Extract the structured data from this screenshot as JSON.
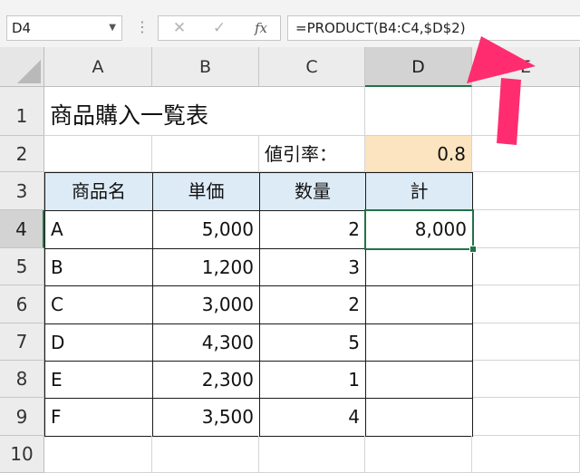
{
  "name_box": {
    "value": "D4"
  },
  "formula_bar": {
    "cancel": "✕",
    "enter": "✓",
    "fx": "fx",
    "formula": "=PRODUCT(B4:C4,$D$2)"
  },
  "columns": [
    "A",
    "B",
    "C",
    "D",
    "E"
  ],
  "rows": [
    "1",
    "2",
    "3",
    "4",
    "5",
    "6",
    "7",
    "8",
    "9",
    "10"
  ],
  "cells": {
    "A1": "商品購入一覧表",
    "C2": "値引率：",
    "D2": "0.8",
    "A3": "商品名",
    "B3": "単価",
    "C3": "数量",
    "D3": "計",
    "D4": "8,000"
  },
  "table_rows": [
    {
      "name": "A",
      "price": "5,000",
      "qty": "2"
    },
    {
      "name": "B",
      "price": "1,200",
      "qty": "3"
    },
    {
      "name": "C",
      "price": "3,000",
      "qty": "2"
    },
    {
      "name": "D",
      "price": "4,300",
      "qty": "5"
    },
    {
      "name": "E",
      "price": "2,300",
      "qty": "1"
    },
    {
      "name": "F",
      "price": "3,500",
      "qty": "4"
    }
  ],
  "colors": {
    "header_fill": "#ddebf7",
    "rate_fill": "#fce4c0",
    "selection": "#217346",
    "arrow": "#ff2d6f"
  }
}
